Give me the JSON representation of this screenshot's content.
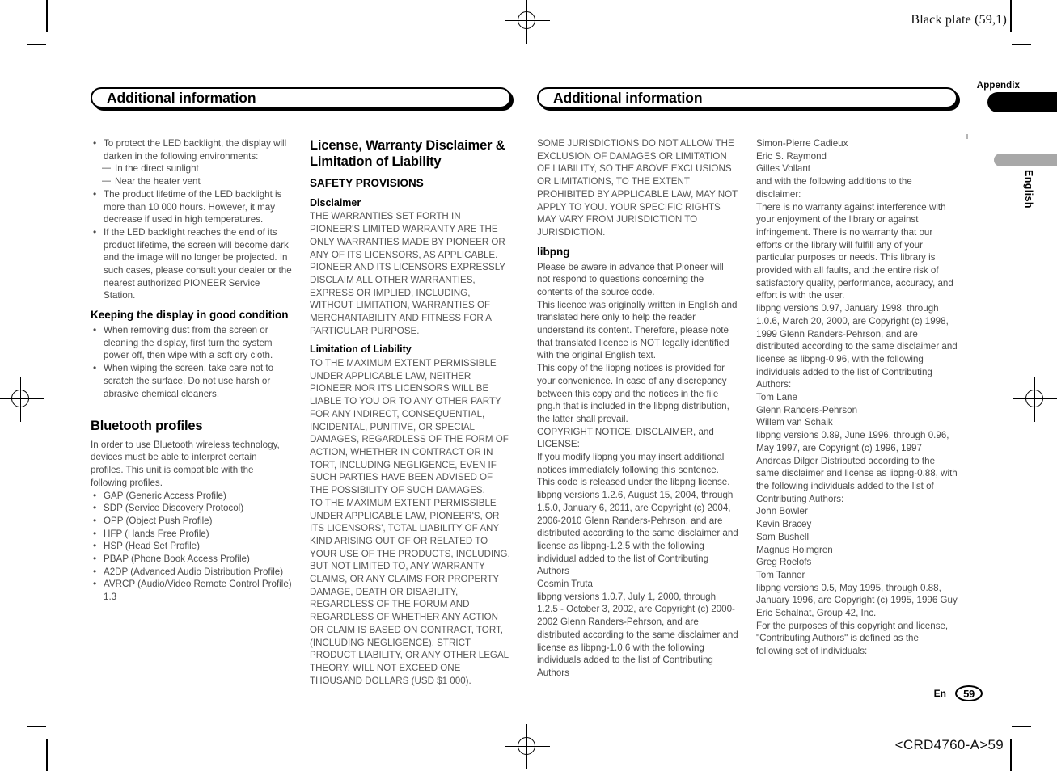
{
  "print_marks": {
    "plate_slug": "Black plate (59,1)",
    "doc_code": "<CRD4760-A>59"
  },
  "thumb_tab": {
    "appendix_label": "Appendix",
    "language_label": "English"
  },
  "folio": {
    "language_code": "En",
    "page_number": "59"
  },
  "left_page": {
    "header_title": "Additional information",
    "column_1": {
      "intro_bullets": [
        {
          "type": "bullet",
          "text": "To protect the LED backlight, the display will darken in the following environments:"
        },
        {
          "type": "dash",
          "text": "In the direct sunlight"
        },
        {
          "type": "dash",
          "text": "Near the heater vent"
        },
        {
          "type": "bullet",
          "text": "The product lifetime of the LED backlight is more than 10 000 hours. However, it may decrease if used in high temperatures."
        },
        {
          "type": "bullet",
          "text": "If the LED backlight reaches the end of its product lifetime, the screen will become dark and the image will no longer be projected. In such cases, please consult your dealer or the nearest authorized PIONEER Service Station."
        }
      ],
      "keeping_heading": "Keeping the display in good condition",
      "keeping_bullets": [
        "When removing dust from the screen or cleaning the display, first turn the system power off, then wipe with a soft dry cloth.",
        "When wiping the screen, take care not to scratch the surface. Do not use harsh or abrasive chemical cleaners."
      ],
      "bluetooth_heading": "Bluetooth profiles",
      "bluetooth_intro": "In order to use Bluetooth wireless technology, devices must be able to interpret certain profiles. This unit is compatible with the following profiles.",
      "bluetooth_profiles": [
        "GAP (Generic Access Profile)",
        "SDP (Service Discovery Protocol)",
        "OPP (Object Push Profile)",
        "HFP (Hands Free Profile)",
        "HSP (Head Set Profile)",
        "PBAP (Phone Book Access Profile)",
        "A2DP (Advanced Audio Distribution Profile)",
        "AVRCP (Audio/Video Remote Control Profile) 1.3"
      ]
    },
    "column_2": {
      "license_heading": "License, Warranty Disclaimer & Limitation of Liability",
      "safety_heading": "SAFETY PROVISIONS",
      "disclaimer_heading": "Disclaimer",
      "disclaimer_body": "THE WARRANTIES SET FORTH IN PIONEER'S LIMITED WARRANTY ARE THE ONLY WARRANTIES MADE BY PIONEER OR ANY OF ITS LICENSORS, AS APPLICABLE. PIONEER AND ITS LICENSORS EXPRESSLY DISCLAIM ALL OTHER WARRANTIES, EXPRESS OR IMPLIED, INCLUDING, WITHOUT LIMITATION, WARRANTIES OF MERCHANTABILITY AND FITNESS FOR A PARTICULAR PURPOSE.",
      "limitation_heading": "Limitation of Liability",
      "limitation_body_1": "TO THE MAXIMUM EXTENT PERMISSIBLE UNDER APPLICABLE LAW, NEITHER PIONEER NOR ITS LICENSORS WILL BE LIABLE TO YOU OR TO ANY OTHER PARTY FOR ANY INDIRECT, CONSEQUENTIAL, INCIDENTAL, PUNITIVE, OR SPECIAL DAMAGES, REGARDLESS OF THE FORM OF ACTION, WHETHER IN CONTRACT OR IN TORT, INCLUDING NEGLIGENCE, EVEN IF SUCH PARTIES HAVE BEEN ADVISED OF THE POSSIBILITY OF SUCH DAMAGES.",
      "limitation_body_2": "TO THE MAXIMUM EXTENT PERMISSIBLE UNDER APPLICABLE LAW, PIONEER'S, OR ITS LICENSORS', TOTAL LIABILITY OF ANY KIND ARISING OUT OF OR RELATED TO YOUR USE OF THE PRODUCTS, INCLUDING, BUT NOT LIMITED TO, ANY WARRANTY CLAIMS, OR ANY CLAIMS FOR PROPERTY DAMAGE, DEATH OR DISABILITY, REGARDLESS OF THE FORUM AND REGARDLESS OF WHETHER ANY ACTION OR CLAIM IS BASED ON CONTRACT, TORT, (INCLUDING NEGLIGENCE), STRICT PRODUCT LIABILITY, OR ANY OTHER LEGAL THEORY, WILL NOT EXCEED ONE THOUSAND DOLLARS (USD $1 000)."
    }
  },
  "right_page": {
    "header_title": "Additional information",
    "column_1": {
      "jurisdiction_body": "SOME JURISDICTIONS DO NOT ALLOW THE EXCLUSION OF DAMAGES OR LIMITATION OF LIABILITY, SO THE ABOVE EXCLUSIONS OR LIMITATIONS, TO THE EXTENT PROHIBITED BY APPLICABLE LAW, MAY NOT APPLY TO YOU. YOUR SPECIFIC RIGHTS MAY VARY FROM JURISDICTION TO JURISDICTION.",
      "libpng_heading": "libpng",
      "libpng_paragraphs": [
        "Please be aware in advance that Pioneer will not respond to questions concerning the contents of the source code.",
        "This licence was originally written in English and translated here only to help the reader understand its content. Therefore, please note that translated  licence is NOT legally identified with the original English text.",
        "This copy of the libpng notices is provided for your convenience.  In case of any discrepancy between this copy and the notices in the file png.h that is included in the libpng distribution, the latter shall prevail.",
        "COPYRIGHT NOTICE, DISCLAIMER, and LICENSE:",
        "If you modify libpng you may insert additional notices immediately following this sentence.",
        "This code is released under the libpng license.",
        "libpng versions 1.2.6, August 15, 2004, through 1.5.0, January 6, 2011, are Copyright (c) 2004, 2006-2010 Glenn Randers-Pehrson, and are distributed according to the same disclaimer and license as libpng-1.2.5 with the following individual added to the list of Contributing Authors",
        "Cosmin Truta",
        "libpng versions 1.0.7, July 1, 2000, through 1.2.5 - October 3, 2002, are Copyright (c) 2000-2002 Glenn Randers-Pehrson, and are distributed according to the same disclaimer and license as libpng-1.0.6 with the following individuals added to the list of Contributing Authors"
      ]
    },
    "column_2": {
      "paragraphs": [
        "Simon-Pierre Cadieux",
        "Eric S. Raymond",
        "Gilles Vollant",
        "and with the following additions to the disclaimer:",
        "There is no warranty against interference with your enjoyment of the library or against infringement.  There is no warranty that our efforts or the library will fulfill any of your particular purposes or needs.  This library is provided with all faults, and the entire risk of satisfactory quality, performance, accuracy, and effort is with the user.",
        "libpng versions 0.97, January 1998, through 1.0.6, March 20, 2000, are Copyright (c) 1998, 1999 Glenn Randers-Pehrson, and are distributed according to the same disclaimer and license as libpng-0.96, with the following individuals added to the list of Contributing Authors:",
        "Tom Lane",
        "Glenn Randers-Pehrson",
        "Willem van Schaik",
        "libpng versions 0.89, June 1996, through 0.96, May 1997, are Copyright (c) 1996, 1997 Andreas Dilger Distributed according to the same disclaimer and license as libpng-0.88, with the following individuals added to the list of Contributing Authors:",
        "John Bowler",
        "Kevin Bracey",
        "Sam Bushell",
        "Magnus Holmgren",
        "Greg Roelofs",
        "Tom Tanner",
        "libpng versions 0.5, May 1995, through 0.88, January 1996, are Copyright (c) 1995, 1996 Guy Eric Schalnat, Group 42, Inc.",
        "For the purposes of this copyright and license, \"Contributing Authors\" is defined as the following set of individuals:"
      ]
    }
  }
}
